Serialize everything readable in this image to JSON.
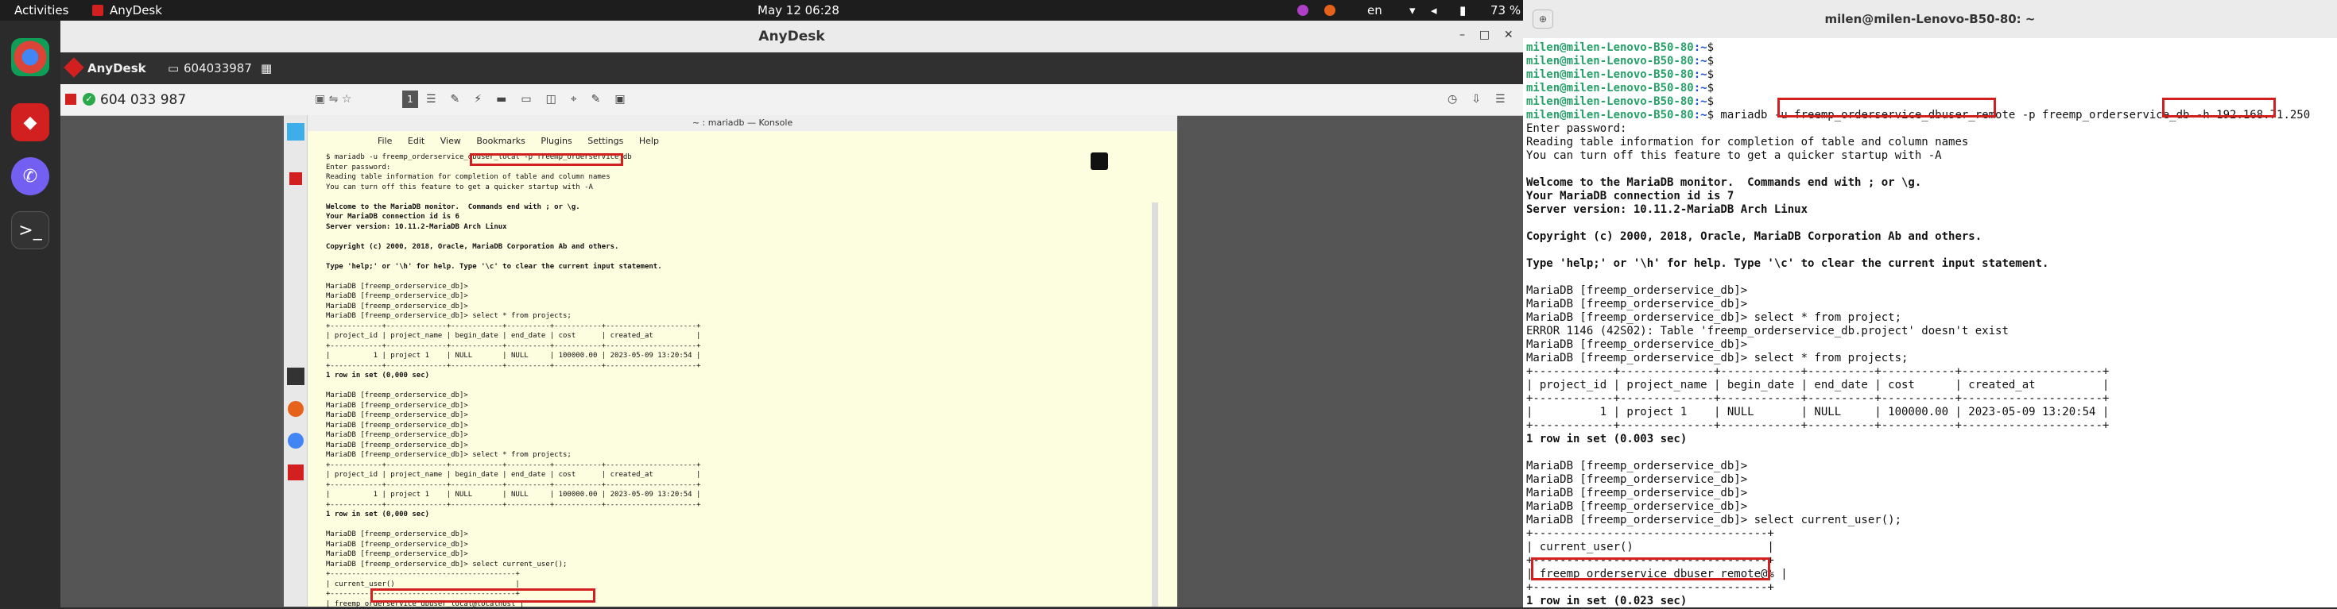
{
  "topbar": {
    "activities": "Activities",
    "app": "AnyDesk",
    "clock": "May 12  06:28",
    "lang": "en",
    "battery": "73 %"
  },
  "anydesk": {
    "title": "AnyDesk",
    "tab_brand": "AnyDesk",
    "tab_id": "604033987",
    "address": "604 033 987"
  },
  "konsole": {
    "title": "~ : mariadb — Konsole",
    "menu": [
      "File",
      "Edit",
      "View",
      "Bookmarks",
      "Plugins",
      "Settings",
      "Help"
    ],
    "lines": [
      "$ mariadb -u freemp_orderservice_dbuser_local -p freemp_orderservice_db",
      "Enter password:",
      "Reading table information for completion of table and column names",
      "You can turn off this feature to get a quicker startup with -A",
      "",
      "Welcome to the MariaDB monitor.  Commands end with ; or \\g.",
      "Your MariaDB connection id is 6",
      "Server version: 10.11.2-MariaDB Arch Linux",
      "",
      "Copyright (c) 2000, 2018, Oracle, MariaDB Corporation Ab and others.",
      "",
      "Type 'help;' or '\\h' for help. Type '\\c' to clear the current input statement.",
      "",
      "MariaDB [freemp_orderservice_db]>",
      "MariaDB [freemp_orderservice_db]>",
      "MariaDB [freemp_orderservice_db]>",
      "MariaDB [freemp_orderservice_db]> select * from projects;",
      "+------------+--------------+------------+----------+-----------+---------------------+",
      "| project_id | project_name | begin_date | end_date | cost      | created_at          |",
      "+------------+--------------+------------+----------+-----------+---------------------+",
      "|          1 | project 1    | NULL       | NULL     | 100000.00 | 2023-05-09 13:20:54 |",
      "+------------+--------------+------------+----------+-----------+---------------------+",
      "1 row in set (0,000 sec)",
      "",
      "MariaDB [freemp_orderservice_db]>",
      "MariaDB [freemp_orderservice_db]>",
      "MariaDB [freemp_orderservice_db]>",
      "MariaDB [freemp_orderservice_db]>",
      "MariaDB [freemp_orderservice_db]>",
      "MariaDB [freemp_orderservice_db]>",
      "MariaDB [freemp_orderservice_db]> select * from projects;",
      "+------------+--------------+------------+----------+-----------+---------------------+",
      "| project_id | project_name | begin_date | end_date | cost      | created_at          |",
      "+------------+--------------+------------+----------+-----------+---------------------+",
      "|          1 | project 1    | NULL       | NULL     | 100000.00 | 2023-05-09 13:20:54 |",
      "+------------+--------------+------------+----------+-----------+---------------------+",
      "1 row in set (0,000 sec)",
      "",
      "MariaDB [freemp_orderservice_db]>",
      "MariaDB [freemp_orderservice_db]>",
      "MariaDB [freemp_orderservice_db]>",
      "MariaDB [freemp_orderservice_db]> select current_user();",
      "+-------------------------------------------+",
      "| current_user()                            |",
      "+-------------------------------------------+",
      "| freemp_orderservice_dbuser_local@localhost |"
    ]
  },
  "terminal": {
    "title": "milen@milen-Lenovo-B50-80: ~",
    "prompt": "milen@milen-Lenovo-B50-80",
    "lines": [
      {
        "p": true,
        "t": ":~$"
      },
      {
        "p": true,
        "t": ":~$"
      },
      {
        "p": true,
        "t": ":~$"
      },
      {
        "p": true,
        "t": ":~$"
      },
      {
        "p": true,
        "t": ":~$"
      },
      {
        "p": true,
        "t": ":~$ mariadb -u freemp_orderservice_dbuser_remote -p freemp_orderservice_db -h 192.168.71.250"
      },
      {
        "t": "Enter password:"
      },
      {
        "t": "Reading table information for completion of table and column names"
      },
      {
        "t": "You can turn off this feature to get a quicker startup with -A"
      },
      {
        "t": ""
      },
      {
        "t": "Welcome to the MariaDB monitor.  Commands end with ; or \\g.",
        "b": true
      },
      {
        "t": "Your MariaDB connection id is 7",
        "b": true
      },
      {
        "t": "Server version: 10.11.2-MariaDB Arch Linux",
        "b": true
      },
      {
        "t": ""
      },
      {
        "t": "Copyright (c) 2000, 2018, Oracle, MariaDB Corporation Ab and others.",
        "b": true
      },
      {
        "t": ""
      },
      {
        "t": "Type 'help;' or '\\h' for help. Type '\\c' to clear the current input statement.",
        "b": true
      },
      {
        "t": ""
      },
      {
        "t": "MariaDB [freemp_orderservice_db]>"
      },
      {
        "t": "MariaDB [freemp_orderservice_db]>"
      },
      {
        "t": "MariaDB [freemp_orderservice_db]> select * from project;"
      },
      {
        "t": "ERROR 1146 (42S02): Table 'freemp_orderservice_db.project' doesn't exist"
      },
      {
        "t": "MariaDB [freemp_orderservice_db]>"
      },
      {
        "t": "MariaDB [freemp_orderservice_db]> select * from projects;"
      },
      {
        "t": "+------------+--------------+------------+----------+-----------+---------------------+"
      },
      {
        "t": "| project_id | project_name | begin_date | end_date | cost      | created_at          |"
      },
      {
        "t": "+------------+--------------+------------+----------+-----------+---------------------+"
      },
      {
        "t": "|          1 | project 1    | NULL       | NULL     | 100000.00 | 2023-05-09 13:20:54 |"
      },
      {
        "t": "+------------+--------------+------------+----------+-----------+---------------------+"
      },
      {
        "t": "1 row in set (0.003 sec)",
        "b": true
      },
      {
        "t": ""
      },
      {
        "t": "MariaDB [freemp_orderservice_db]>"
      },
      {
        "t": "MariaDB [freemp_orderservice_db]>"
      },
      {
        "t": "MariaDB [freemp_orderservice_db]>"
      },
      {
        "t": "MariaDB [freemp_orderservice_db]>"
      },
      {
        "t": "MariaDB [freemp_orderservice_db]> select current_user();"
      },
      {
        "t": "+-----------------------------------+"
      },
      {
        "t": "| current_user()                    |"
      },
      {
        "t": "+-----------------------------------+"
      },
      {
        "t": "| freemp_orderservice_dbuser_remote@% |"
      },
      {
        "t": "+-----------------------------------+"
      },
      {
        "t": "1 row in set (0.023 sec)",
        "b": true
      }
    ]
  }
}
